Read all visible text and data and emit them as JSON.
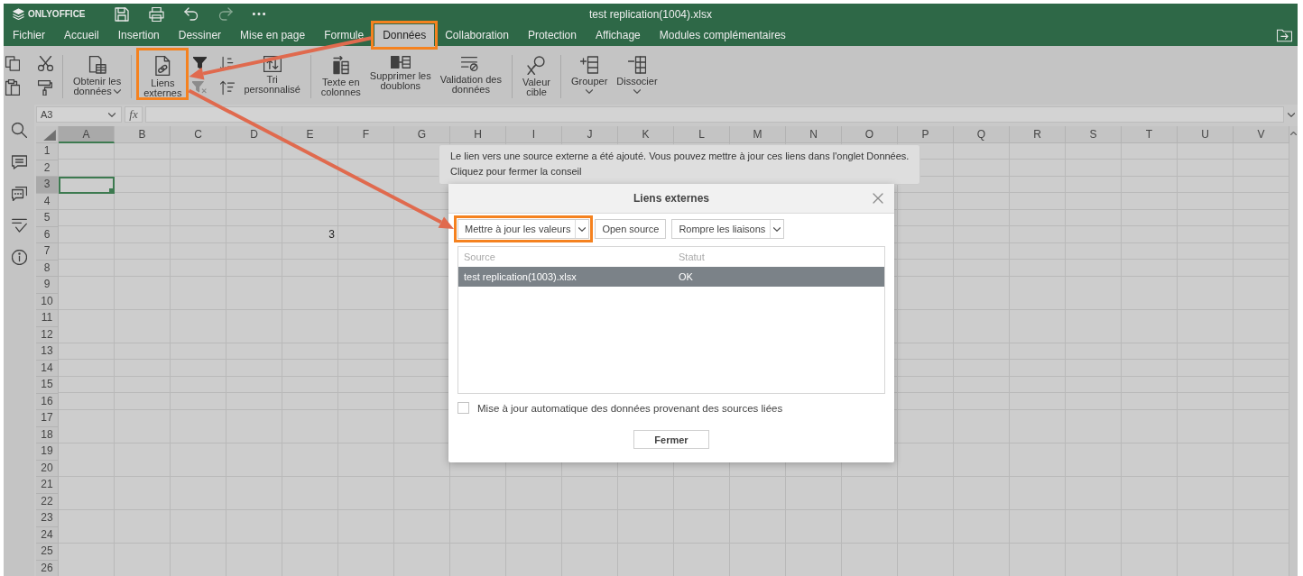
{
  "title_bar": {
    "logo": "ONLYOFFICE",
    "quick_access": [
      {
        "disabled": false
      },
      {
        "disabled": false
      },
      {
        "disabled": false
      },
      {
        "disabled": true
      },
      {
        "disabled": false
      }
    ],
    "document_title": "test replication(1004).xlsx"
  },
  "menu_tabs": [
    {
      "label": "Fichier",
      "selected": false,
      "highlighted": false
    },
    {
      "label": "Accueil",
      "selected": false,
      "highlighted": false
    },
    {
      "label": "Insertion",
      "selected": false,
      "highlighted": false
    },
    {
      "label": "Dessiner",
      "selected": false,
      "highlighted": false
    },
    {
      "label": "Mise en page",
      "selected": false,
      "highlighted": false
    },
    {
      "label": "Formule",
      "selected": false,
      "highlighted": false
    },
    {
      "label": "Données",
      "selected": true,
      "highlighted": true
    },
    {
      "label": "Collaboration",
      "selected": false,
      "highlighted": false
    },
    {
      "label": "Protection",
      "selected": false,
      "highlighted": false
    },
    {
      "label": "Affichage",
      "selected": false,
      "highlighted": false
    },
    {
      "label": "Modules complémentaires",
      "selected": false,
      "highlighted": false
    }
  ],
  "toolbar": {
    "items": [
      {
        "kind": "icon_grid",
        "tools": [
          {
            "disabled": false
          },
          {
            "disabled": false
          },
          {
            "disabled": false
          },
          {
            "disabled": false
          }
        ]
      },
      {
        "kind": "separator"
      },
      {
        "kind": "large",
        "lines": [
          "Obtenir les",
          "données"
        ],
        "dropdown": true,
        "highlighted": false
      },
      {
        "kind": "separator"
      },
      {
        "kind": "large",
        "lines": [
          "Liens",
          "externes"
        ],
        "dropdown": false,
        "highlighted": true
      },
      {
        "kind": "icon_grid",
        "tools": [
          {
            "disabled": false
          },
          {
            "disabled": false
          },
          {
            "disabled": true
          },
          {
            "disabled": false
          }
        ]
      },
      {
        "kind": "large",
        "lines": [
          "Tri",
          "personnalisé"
        ],
        "dropdown": false,
        "highlighted": false
      },
      {
        "kind": "separator"
      },
      {
        "kind": "large",
        "lines": [
          "Texte en",
          "colonnes"
        ],
        "dropdown": false,
        "highlighted": false
      },
      {
        "kind": "large",
        "lines": [
          "Supprimer les",
          "doublons"
        ],
        "dropdown": false,
        "highlighted": false
      },
      {
        "kind": "large",
        "lines": [
          "Validation des",
          "données"
        ],
        "dropdown": false,
        "highlighted": false
      },
      {
        "kind": "separator"
      },
      {
        "kind": "large",
        "lines": [
          "Valeur",
          "cible"
        ],
        "dropdown": false,
        "highlighted": false
      },
      {
        "kind": "separator"
      },
      {
        "kind": "large",
        "lines": [
          "Grouper"
        ],
        "dropdown": true,
        "highlighted": false
      },
      {
        "kind": "large",
        "lines": [
          "Dissocier"
        ],
        "dropdown": true,
        "highlighted": false
      }
    ]
  },
  "formula_bar": {
    "cell_name": "A3",
    "function_label": "fx"
  },
  "sheet": {
    "columns": [
      {
        "label": "A",
        "selected": true
      },
      {
        "label": "B",
        "selected": false
      },
      {
        "label": "C",
        "selected": false
      },
      {
        "label": "D",
        "selected": false
      },
      {
        "label": "E",
        "selected": false
      },
      {
        "label": "F",
        "selected": false
      },
      {
        "label": "G",
        "selected": false
      },
      {
        "label": "H",
        "selected": false
      },
      {
        "label": "I",
        "selected": false
      },
      {
        "label": "J",
        "selected": false
      },
      {
        "label": "K",
        "selected": false
      },
      {
        "label": "L",
        "selected": false
      },
      {
        "label": "M",
        "selected": false
      },
      {
        "label": "N",
        "selected": false
      },
      {
        "label": "O",
        "selected": false
      },
      {
        "label": "P",
        "selected": false
      },
      {
        "label": "Q",
        "selected": false
      },
      {
        "label": "R",
        "selected": false
      },
      {
        "label": "S",
        "selected": false
      },
      {
        "label": "T",
        "selected": false
      },
      {
        "label": "U",
        "selected": false
      },
      {
        "label": "V",
        "selected": false
      }
    ],
    "rows": [
      {
        "header": "1",
        "selected": false
      },
      {
        "header": "2",
        "selected": false
      },
      {
        "header": "3",
        "selected": true,
        "cells": [
          {
            "selected": true
          }
        ]
      },
      {
        "header": "4",
        "selected": false
      },
      {
        "header": "5",
        "selected": false
      },
      {
        "header": "6",
        "selected": false,
        "cells": [
          {
            "selected": false
          },
          {
            "selected": false
          },
          {
            "selected": false
          },
          {
            "selected": false
          },
          {
            "selected": false,
            "value": "3"
          }
        ]
      },
      {
        "header": "7",
        "selected": false
      },
      {
        "header": "8",
        "selected": false
      },
      {
        "header": "9",
        "selected": false
      },
      {
        "header": "10",
        "selected": false
      },
      {
        "header": "11",
        "selected": false
      },
      {
        "header": "12",
        "selected": false
      },
      {
        "header": "13",
        "selected": false
      },
      {
        "header": "14",
        "selected": false
      },
      {
        "header": "15",
        "selected": false
      },
      {
        "header": "16",
        "selected": false
      },
      {
        "header": "17",
        "selected": false
      },
      {
        "header": "18",
        "selected": false
      },
      {
        "header": "19",
        "selected": false
      },
      {
        "header": "20",
        "selected": false
      },
      {
        "header": "21",
        "selected": false
      },
      {
        "header": "22",
        "selected": false
      },
      {
        "header": "23",
        "selected": false
      },
      {
        "header": "24",
        "selected": false
      },
      {
        "header": "25",
        "selected": false
      },
      {
        "header": "26",
        "selected": false
      }
    ]
  },
  "tooltip": {
    "lines": [
      "Le lien vers une source externe a été ajouté. Vous pouvez mettre à jour ces liens dans l'onglet Données.",
      "Cliquez pour fermer la conseil"
    ]
  },
  "dialog": {
    "title": "Liens externes",
    "buttons": [
      {
        "label": "Mettre à jour les valeurs",
        "dropdown": true,
        "highlighted": true
      },
      {
        "label": "Open source",
        "dropdown": false,
        "highlighted": false
      },
      {
        "label": "Rompre les liaisons",
        "dropdown": true,
        "highlighted": false
      }
    ],
    "table": {
      "columns": [
        "Source",
        "Statut"
      ],
      "rows": [
        {
          "cells": [
            "test replication(1003).xlsx",
            "OK"
          ],
          "selected": true
        }
      ]
    },
    "auto_update": {
      "label": "Mise à jour automatique des données provenant des sources liées",
      "checked": false
    },
    "close_button": "Fermer"
  }
}
